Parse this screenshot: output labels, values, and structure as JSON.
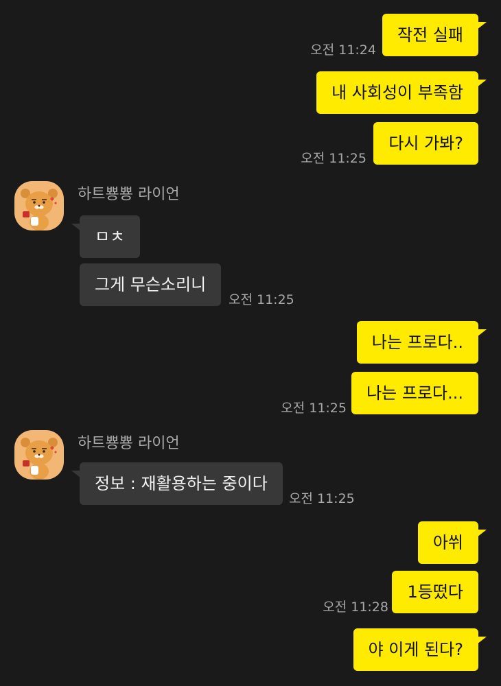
{
  "messages": [
    {
      "text": "작전 실패"
    },
    {
      "text": "내 사회성이 부족함"
    },
    {
      "text": "다시 가봐?"
    },
    {
      "text": "ㅁㅊ"
    },
    {
      "text": "그게 무슨소리니"
    },
    {
      "text": "나는 프로다.."
    },
    {
      "text": "나는 프로다..."
    },
    {
      "text": "정보 : 재활용하는 중이다"
    },
    {
      "text": "아쒸"
    },
    {
      "text": "1등떴다"
    },
    {
      "text": "야 이게 된다?"
    }
  ],
  "times": [
    "오전 11:24",
    "오전 11:25",
    "오전 11:25",
    "오전 11:25",
    "오전 11:25",
    "오전 11:28"
  ],
  "senders": [
    "하트뿅뿅 라이언",
    "하트뿅뿅 라이언"
  ],
  "colors": {
    "background": "#1a1a1a",
    "my_bubble": "#ffeb00",
    "other_bubble": "#383838",
    "meta_text": "#a9a9a9",
    "avatar_bg": "#f2b774"
  }
}
